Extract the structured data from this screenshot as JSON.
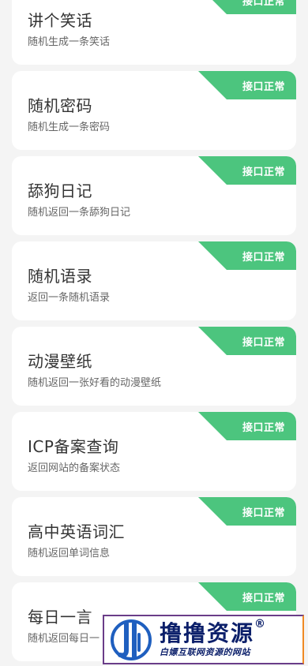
{
  "cards": [
    {
      "title": "讲个笑话",
      "desc": "随机生成一条笑话",
      "status": "接口正常"
    },
    {
      "title": "随机密码",
      "desc": "随机生成一条密码",
      "status": "接口正常"
    },
    {
      "title": "舔狗日记",
      "desc": "随机返回一条舔狗日记",
      "status": "接口正常"
    },
    {
      "title": "随机语录",
      "desc": "返回一条随机语录",
      "status": "接口正常"
    },
    {
      "title": "动漫壁纸",
      "desc": "随机返回一张好看的动漫壁纸",
      "status": "接口正常"
    },
    {
      "title": "ICP备案查询",
      "desc": "返回网站的备案状态",
      "status": "接口正常"
    },
    {
      "title": "高中英语词汇",
      "desc": "随机返回单词信息",
      "status": "接口正常"
    },
    {
      "title": "每日一言",
      "desc": "随机返回每日一",
      "status": "接口正常"
    }
  ],
  "colors": {
    "status_green": "#4cc57e",
    "card_bg": "#ffffff",
    "page_bg": "#f4f4f4"
  },
  "watermark": {
    "title": "撸撸资源",
    "registered": "®",
    "subtitle": "白嫖互联网资源的网站"
  }
}
